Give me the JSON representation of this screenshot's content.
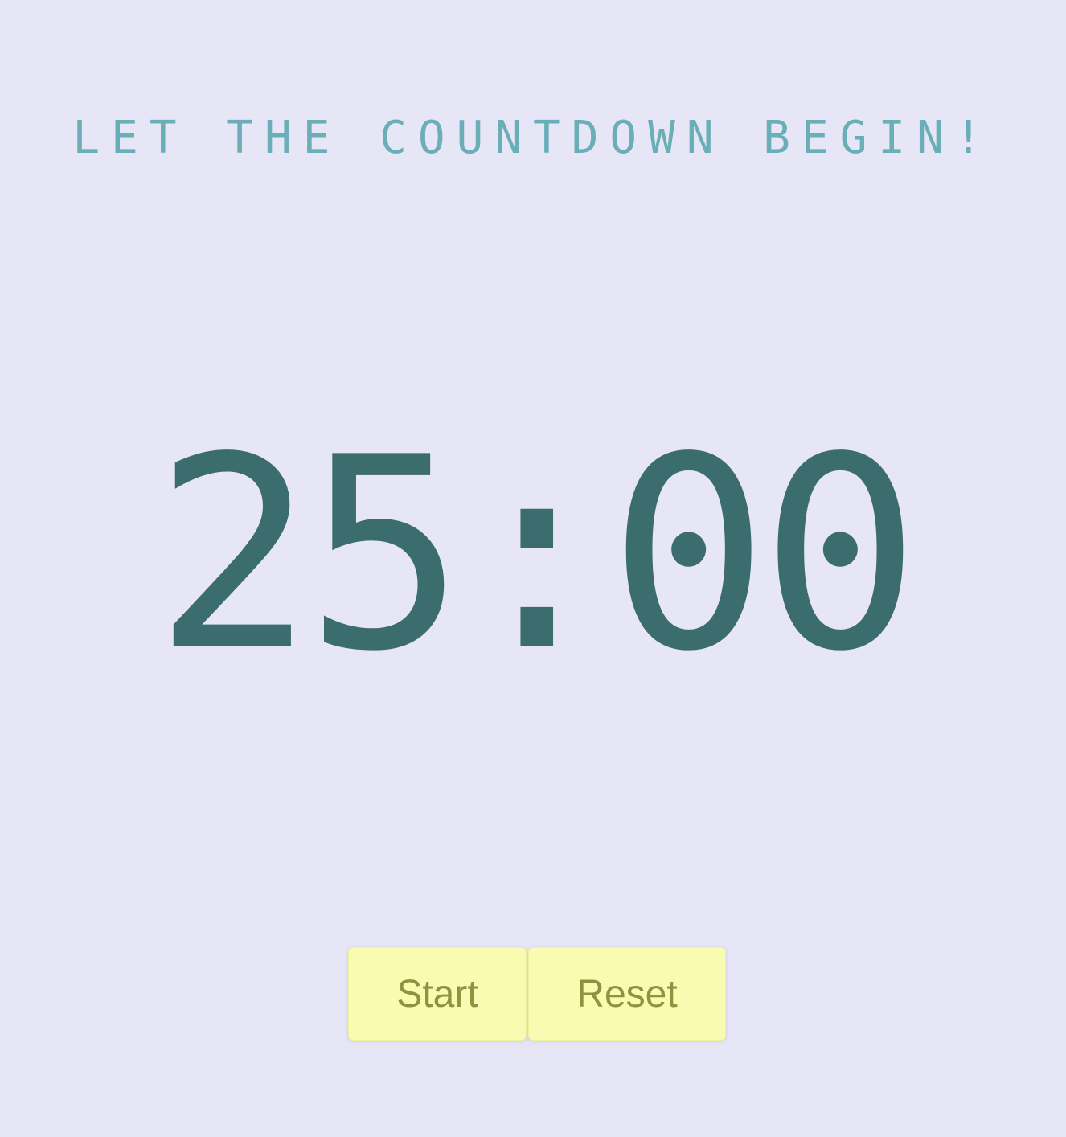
{
  "header": {
    "title": "LET THE COUNTDOWN BEGIN!"
  },
  "timer": {
    "display": "25:00"
  },
  "controls": {
    "start_label": "Start",
    "reset_label": "Reset"
  },
  "colors": {
    "background": "#e7e6f7",
    "headline": "#6aaeb8",
    "timer": "#3b6d6f",
    "button_bg": "#f8fbb0",
    "button_text": "#8f9340"
  }
}
